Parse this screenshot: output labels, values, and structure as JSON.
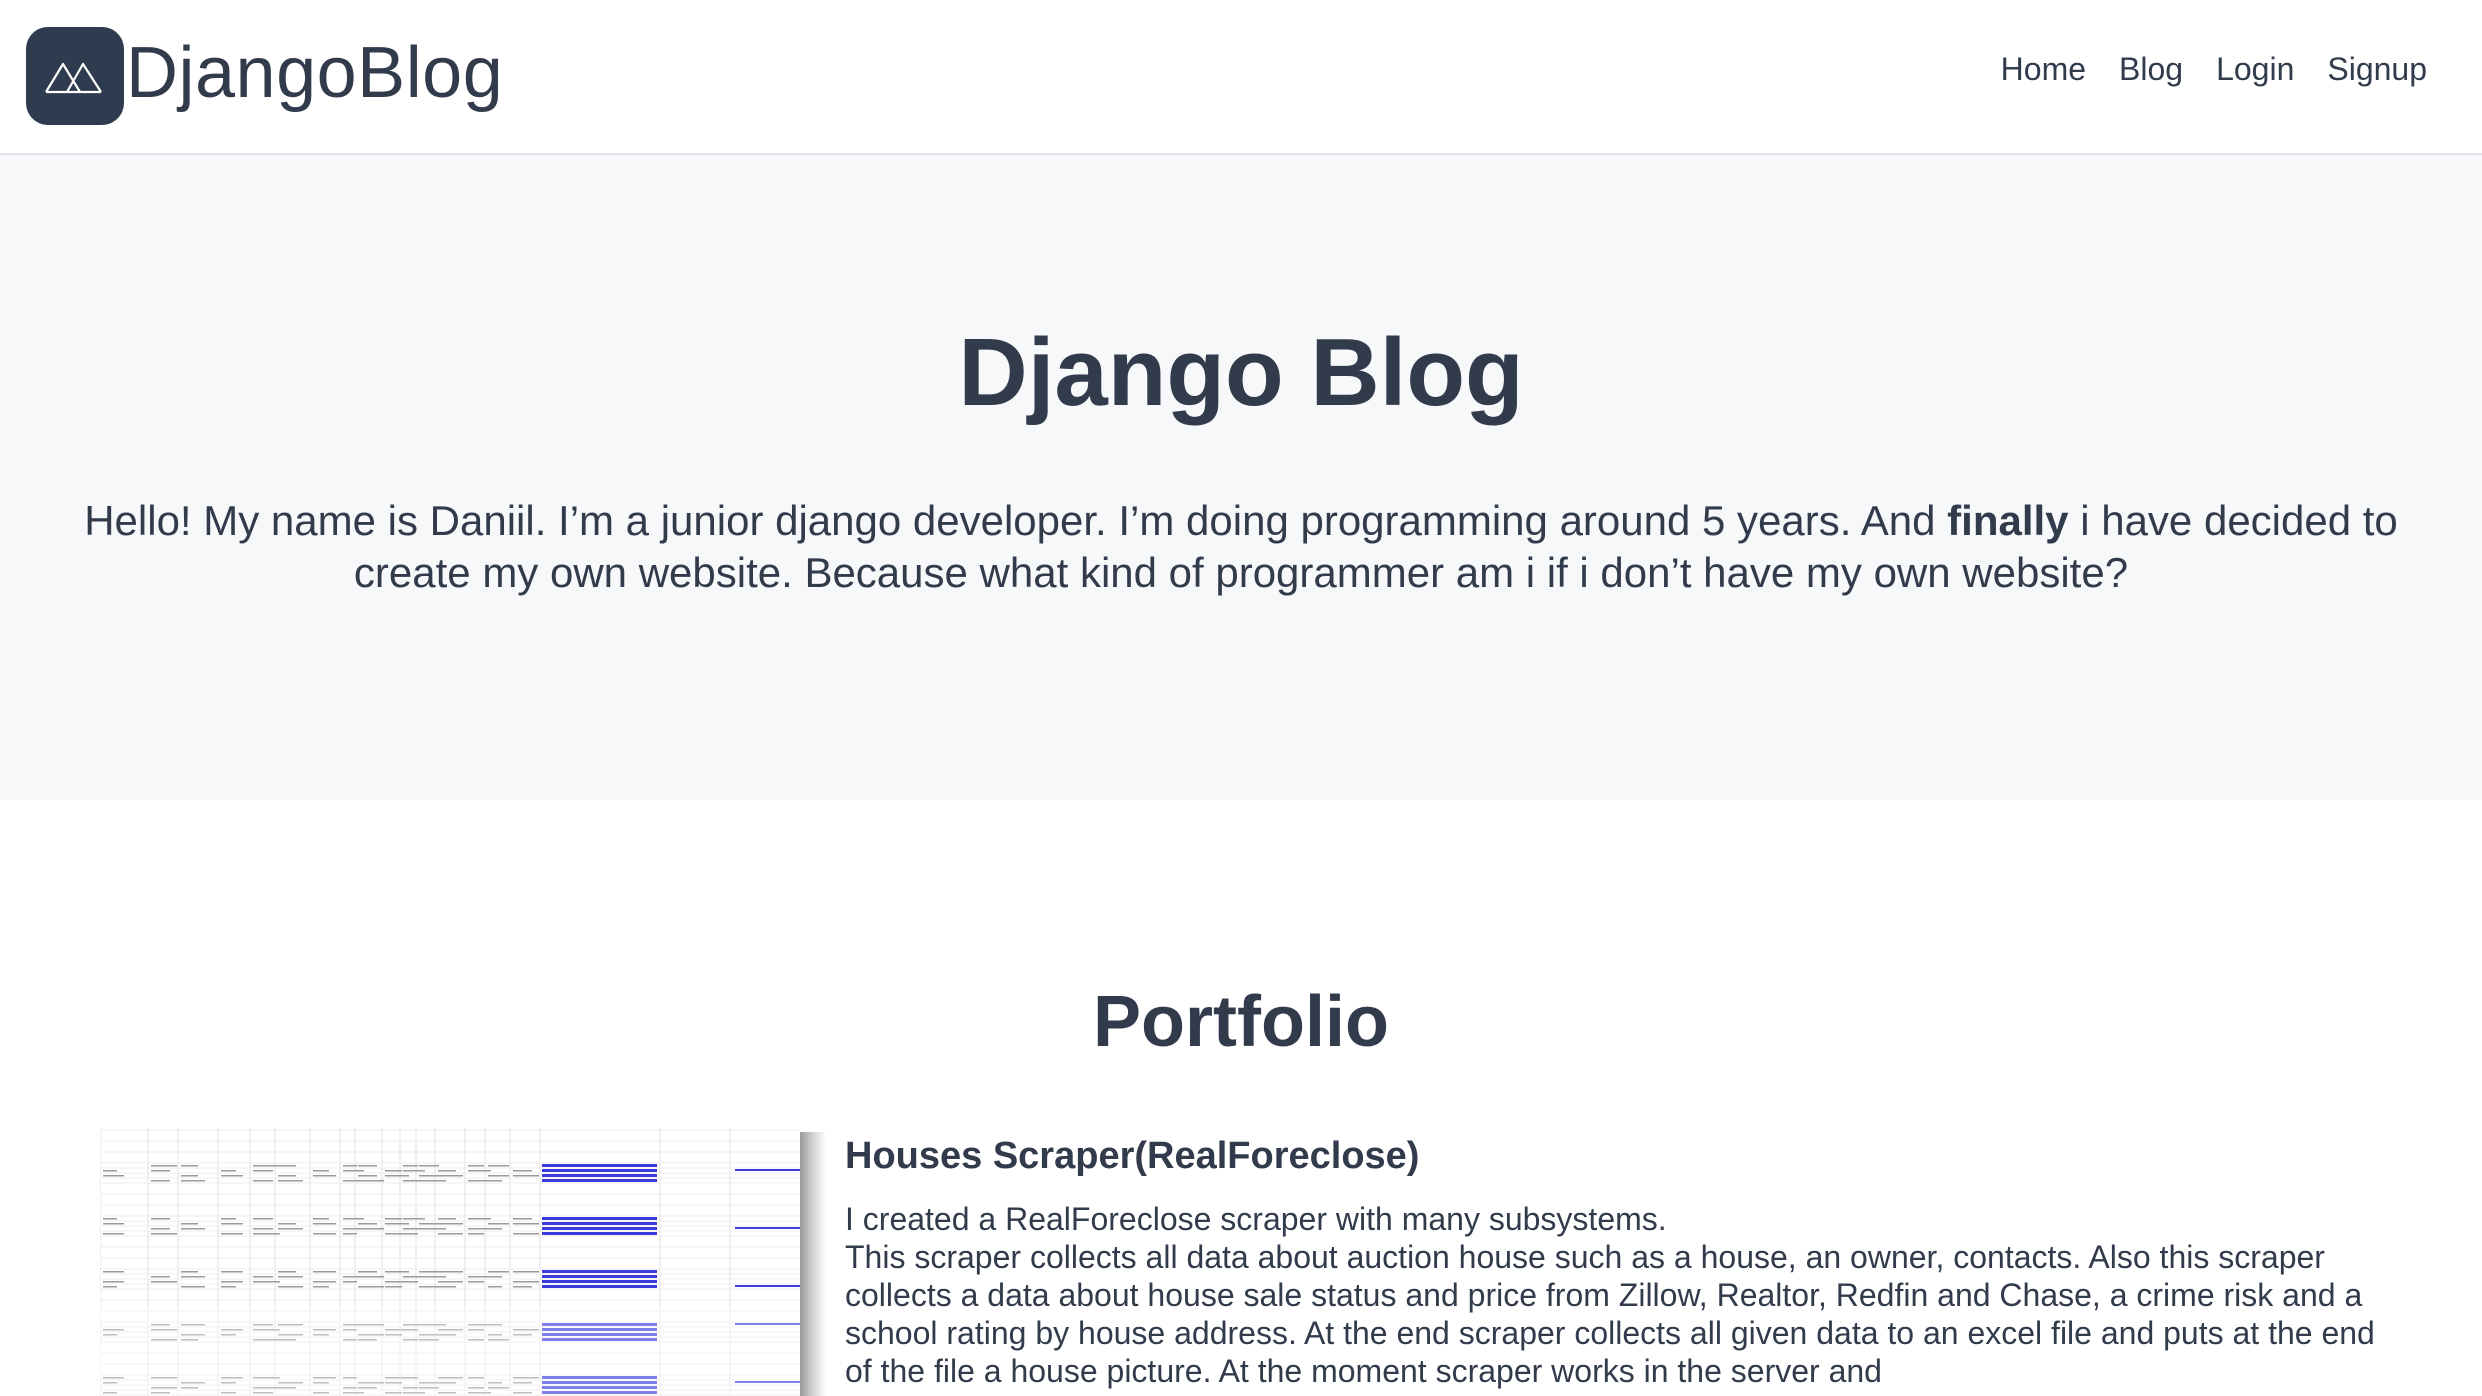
{
  "header": {
    "brand": "DjangoBlog",
    "nav": [
      {
        "label": "Home"
      },
      {
        "label": "Blog"
      },
      {
        "label": "Login"
      },
      {
        "label": "Signup"
      }
    ]
  },
  "hero": {
    "title": "Django Blog",
    "intro_before": "Hello! My name is Daniil. I’m a junior django developer. I’m doing programming around 5 years. And ",
    "intro_bold": "finally",
    "intro_after": " i have decided to create my own website. Because what kind of programmer am i if i don’t have my own website?"
  },
  "portfolio": {
    "title": "Portfolio",
    "projects": [
      {
        "title": "Houses Scraper(RealForeclose)",
        "description_line1": "I created a RealForeclose scraper with many subsystems.",
        "description_line2": "This scraper collects all data about auction house such as a house, an owner, contacts. Also this scraper collects a data about house sale status and price from Zillow, Realtor, Redfin and Chase, a crime risk and a school rating by house address. At the end scraper collects all given data to an excel file and puts at the end of the file a house picture. At the moment scraper works in the server and"
      }
    ]
  },
  "colors": {
    "text": "#323b4c",
    "logo_bg": "#2f3b4f",
    "hero_bg": "#f7f8fa",
    "link_blue": "#3b3bdd"
  },
  "icons": {
    "logo": "mountain-icon"
  }
}
